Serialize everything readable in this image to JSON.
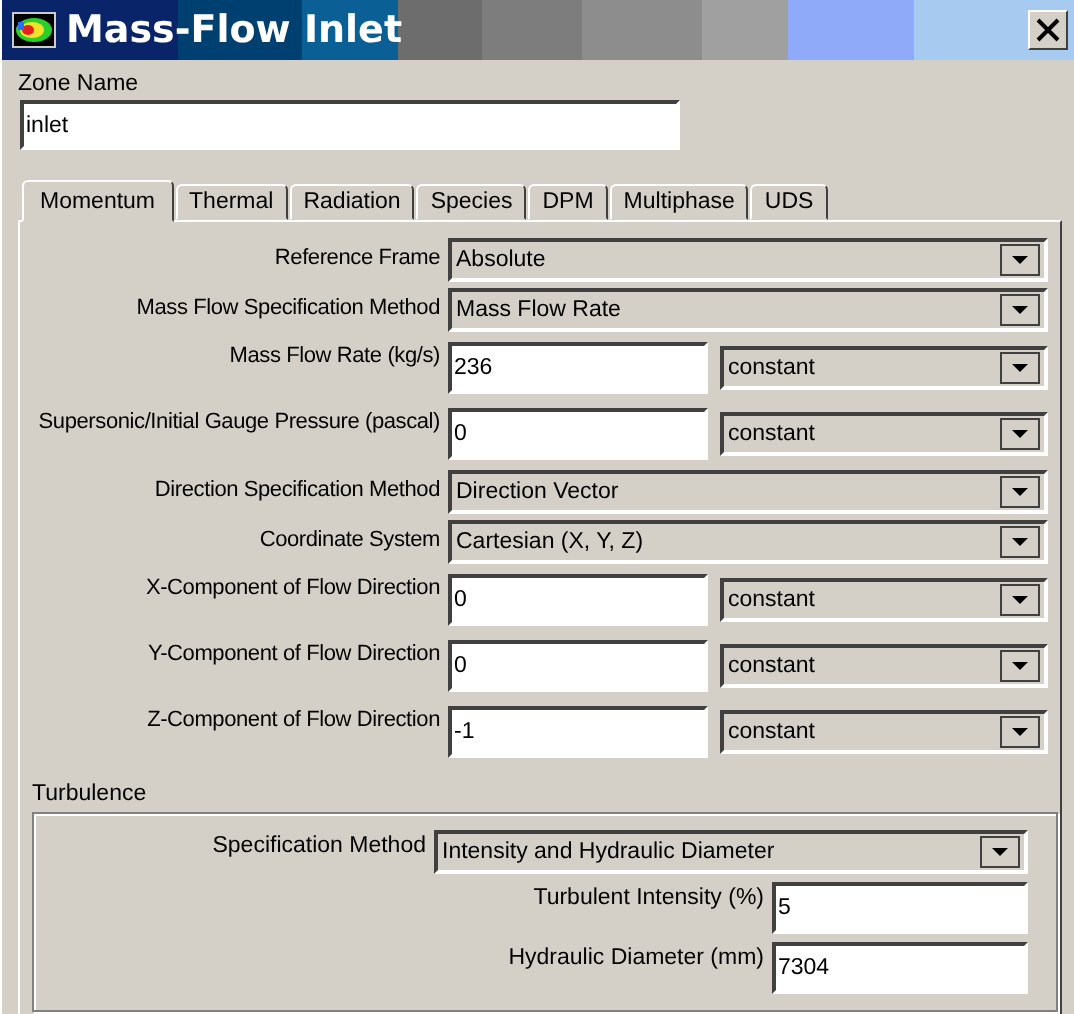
{
  "window": {
    "title": "Mass-Flow Inlet"
  },
  "zone_name": {
    "label": "Zone Name",
    "value": "inlet"
  },
  "tabs": [
    {
      "label": "Momentum",
      "selected": true
    },
    {
      "label": "Thermal",
      "selected": false
    },
    {
      "label": "Radiation",
      "selected": false
    },
    {
      "label": "Species",
      "selected": false
    },
    {
      "label": "DPM",
      "selected": false
    },
    {
      "label": "Multiphase",
      "selected": false
    },
    {
      "label": "UDS",
      "selected": false
    }
  ],
  "fields": [
    {
      "kind": "select",
      "label": "Reference Frame",
      "value": "Absolute"
    },
    {
      "kind": "select",
      "label": "Mass Flow Specification Method",
      "value": "Mass Flow Rate"
    },
    {
      "kind": "value",
      "label": "Mass Flow Rate (kg/s)",
      "value": "236",
      "profile": "constant"
    },
    {
      "kind": "value",
      "label": "Supersonic/Initial Gauge Pressure (pascal)",
      "value": "0",
      "profile": "constant"
    },
    {
      "kind": "select",
      "label": "Direction Specification Method",
      "value": "Direction Vector"
    },
    {
      "kind": "select",
      "label": "Coordinate System",
      "value": "Cartesian (X, Y, Z)"
    },
    {
      "kind": "value",
      "label": "X-Component of Flow Direction",
      "value": "0",
      "profile": "constant"
    },
    {
      "kind": "value",
      "label": "Y-Component of Flow Direction",
      "value": "0",
      "profile": "constant"
    },
    {
      "kind": "value",
      "label": "Z-Component of Flow Direction",
      "value": "-1",
      "profile": "constant"
    }
  ],
  "turbulence": {
    "title": "Turbulence",
    "method": {
      "label": "Specification Method",
      "value": "Intensity and Hydraulic Diameter"
    },
    "fields": [
      {
        "label": "Turbulent Intensity (%)",
        "value": "5"
      },
      {
        "label": "Hydraulic Diameter (mm)",
        "value": "7304"
      }
    ]
  }
}
